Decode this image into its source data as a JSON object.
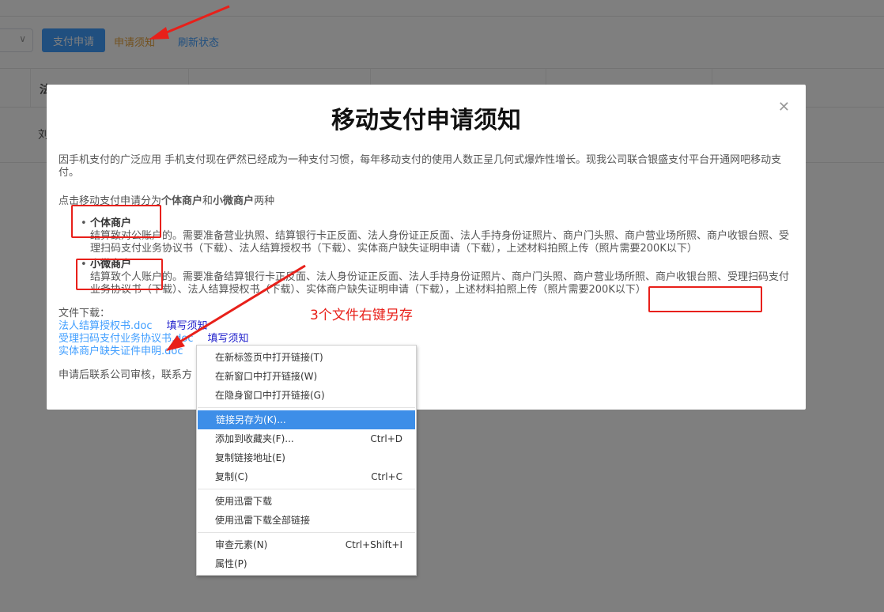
{
  "toolbar": {
    "pay_button": "支付申请",
    "notice_link": "申请须知",
    "refresh_link": "刷新状态"
  },
  "table": {
    "first_header": "法",
    "first_cell": "刘"
  },
  "modal": {
    "title": "移动支付申请须知",
    "close_icon": "close-icon",
    "intro": "因手机支付的广泛应用 手机支付现在俨然已经成为一种支付习惯，每年移动支付的使用人数正呈几何式爆炸性增长。现我公司联合银盛支付平台开通网吧移动支付。",
    "types_prefix": "点击移动支付申请分为",
    "type_a": "个体商户",
    "types_and": "和",
    "type_b": "小微商户",
    "types_suffix": "两种",
    "individual": {
      "name": "个体商户",
      "desc": "结算致对公账户的。需要准备营业执照、结算银行卡正反面、法人身份证正反面、法人手持身份证照片、商户门头照、商户营业场所照、商户收银台照、受理扫码支付业务协议书（下载）、法人结算授权书（下载）、实体商户缺失证明申请（下载），上述材料拍照上传（照片需要200K以下）"
    },
    "small": {
      "name": "小微商户",
      "desc": "结算致个人账户的。需要准备结算银行卡正反面、法人身份证正反面、法人手持身份证照片、商户门头照、商户营业场所照、商户收银台照、受理扫码支付业务协议书（下载）、法人结算授权书（下载）、实体商户缺失证明申请（下载），上述材料拍照上传（照片需要200K以下）"
    },
    "download_label": "文件下载：",
    "files": [
      {
        "name": "法人结算授权书.doc",
        "fill": "填写须知"
      },
      {
        "name": "受理扫码支付业务协议书.doc",
        "fill": "填写须知"
      },
      {
        "name": "实体商户缺失证件申明.doc",
        "fill": ""
      }
    ],
    "footnote": "申请后联系公司审核，联系方"
  },
  "annotation": {
    "text": "3个文件右键另存",
    "color": "#e8201a"
  },
  "context_menu": {
    "groups": [
      [
        {
          "label": "在新标签页中打开链接(T)",
          "shortcut": ""
        },
        {
          "label": "在新窗口中打开链接(W)",
          "shortcut": ""
        },
        {
          "label": "在隐身窗口中打开链接(G)",
          "shortcut": ""
        }
      ],
      [
        {
          "label": "链接另存为(K)...",
          "shortcut": "",
          "active": true
        },
        {
          "label": "添加到收藏夹(F)...",
          "shortcut": "Ctrl+D"
        },
        {
          "label": "复制链接地址(E)",
          "shortcut": ""
        },
        {
          "label": "复制(C)",
          "shortcut": "Ctrl+C"
        }
      ],
      [
        {
          "label": "使用迅雷下载",
          "shortcut": ""
        },
        {
          "label": "使用迅雷下载全部链接",
          "shortcut": ""
        }
      ],
      [
        {
          "label": "审查元素(N)",
          "shortcut": "Ctrl+Shift+I"
        },
        {
          "label": "属性(P)",
          "shortcut": ""
        }
      ]
    ]
  },
  "colors": {
    "primary": "#409eff",
    "warning_link": "#e6a23c",
    "menu_highlight": "#3d8ee8",
    "annotation_red": "#e8201a"
  }
}
